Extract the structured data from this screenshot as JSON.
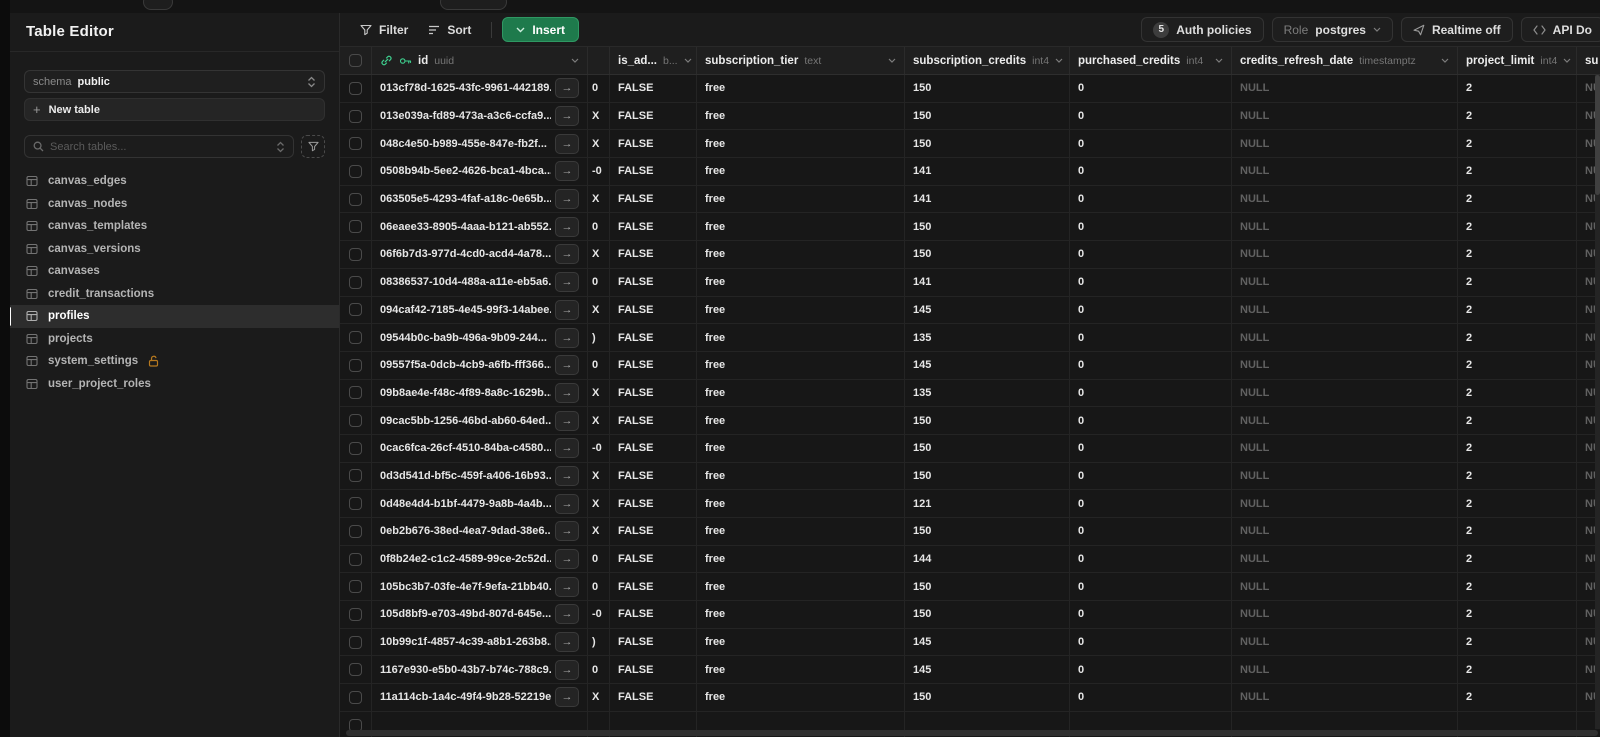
{
  "colors": {
    "accent_green": "#3ecf8e",
    "insert_button_bg": "#1e7a4c",
    "lock_amber": "#b7791f",
    "page_bg": "#171717",
    "sidebar_bg": "#1b1b1b",
    "header_bg": "#1f1f1f",
    "null_text": "#616161"
  },
  "sidebar": {
    "title": "Table Editor",
    "schema_label": "schema",
    "schema_value": "public",
    "new_table_label": "New table",
    "search_placeholder": "Search tables...",
    "tables": [
      {
        "name": "canvas_edges",
        "selected": false,
        "locked": false
      },
      {
        "name": "canvas_nodes",
        "selected": false,
        "locked": false
      },
      {
        "name": "canvas_templates",
        "selected": false,
        "locked": false
      },
      {
        "name": "canvas_versions",
        "selected": false,
        "locked": false
      },
      {
        "name": "canvases",
        "selected": false,
        "locked": false
      },
      {
        "name": "credit_transactions",
        "selected": false,
        "locked": false
      },
      {
        "name": "profiles",
        "selected": true,
        "locked": false
      },
      {
        "name": "projects",
        "selected": false,
        "locked": false
      },
      {
        "name": "system_settings",
        "selected": false,
        "locked": true
      },
      {
        "name": "user_project_roles",
        "selected": false,
        "locked": false
      }
    ]
  },
  "toolbar": {
    "filter_label": "Filter",
    "sort_label": "Sort",
    "insert_label": "Insert",
    "auth_policies_count": "5",
    "auth_policies_label": "Auth policies",
    "role_prefix": "Role",
    "role_value": "postgres",
    "realtime_label": "Realtime off",
    "api_docs_label": "API Do"
  },
  "grid": {
    "columns": [
      {
        "name": "id",
        "type": "uuid"
      },
      {
        "name": "",
        "type": ""
      },
      {
        "name": "is_ad...",
        "type": "b..."
      },
      {
        "name": "subscription_tier",
        "type": "text"
      },
      {
        "name": "subscription_credits",
        "type": "int4"
      },
      {
        "name": "purchased_credits",
        "type": "int4"
      },
      {
        "name": "credits_refresh_date",
        "type": "timestamptz"
      },
      {
        "name": "project_limit",
        "type": "int4"
      },
      {
        "name": "su",
        "type": ""
      }
    ],
    "rows": [
      {
        "id": "013cf78d-1625-43fc-9961-442189...",
        "fragment": "0",
        "is_admin": "FALSE",
        "tier": "free",
        "sub_credits": "150",
        "purchased": "0",
        "refresh": "NULL",
        "limit": "2",
        "su": "NULL"
      },
      {
        "id": "013e039a-fd89-473a-a3c6-ccfa9...",
        "fragment": "X",
        "is_admin": "FALSE",
        "tier": "free",
        "sub_credits": "150",
        "purchased": "0",
        "refresh": "NULL",
        "limit": "2",
        "su": "NULL"
      },
      {
        "id": "048c4e50-b989-455e-847e-fb2f...",
        "fragment": "X",
        "is_admin": "FALSE",
        "tier": "free",
        "sub_credits": "150",
        "purchased": "0",
        "refresh": "NULL",
        "limit": "2",
        "su": "NULL"
      },
      {
        "id": "0508b94b-5ee2-4626-bca1-4bca...",
        "fragment": "-0",
        "is_admin": "FALSE",
        "tier": "free",
        "sub_credits": "141",
        "purchased": "0",
        "refresh": "NULL",
        "limit": "2",
        "su": "NULL"
      },
      {
        "id": "063505e5-4293-4faf-a18c-0e65b...",
        "fragment": "X",
        "is_admin": "FALSE",
        "tier": "free",
        "sub_credits": "141",
        "purchased": "0",
        "refresh": "NULL",
        "limit": "2",
        "su": "NULL"
      },
      {
        "id": "06eaee33-8905-4aaa-b121-ab552...",
        "fragment": "0",
        "is_admin": "FALSE",
        "tier": "free",
        "sub_credits": "150",
        "purchased": "0",
        "refresh": "NULL",
        "limit": "2",
        "su": "NULL"
      },
      {
        "id": "06f6b7d3-977d-4cd0-acd4-4a78...",
        "fragment": "X",
        "is_admin": "FALSE",
        "tier": "free",
        "sub_credits": "150",
        "purchased": "0",
        "refresh": "NULL",
        "limit": "2",
        "su": "NULL"
      },
      {
        "id": "08386537-10d4-488a-a11e-eb5a6...",
        "fragment": "0",
        "is_admin": "FALSE",
        "tier": "free",
        "sub_credits": "141",
        "purchased": "0",
        "refresh": "NULL",
        "limit": "2",
        "su": "NULL"
      },
      {
        "id": "094caf42-7185-4e45-99f3-14abee...",
        "fragment": "X",
        "is_admin": "FALSE",
        "tier": "free",
        "sub_credits": "145",
        "purchased": "0",
        "refresh": "NULL",
        "limit": "2",
        "su": "NULL"
      },
      {
        "id": "09544b0c-ba9b-496a-9b09-244...",
        "fragment": ")",
        "is_admin": "FALSE",
        "tier": "free",
        "sub_credits": "135",
        "purchased": "0",
        "refresh": "NULL",
        "limit": "2",
        "su": "NULL"
      },
      {
        "id": "09557f5a-0dcb-4cb9-a6fb-fff366...",
        "fragment": "0",
        "is_admin": "FALSE",
        "tier": "free",
        "sub_credits": "145",
        "purchased": "0",
        "refresh": "NULL",
        "limit": "2",
        "su": "NULL"
      },
      {
        "id": "09b8ae4e-f48c-4f89-8a8c-1629b...",
        "fragment": "X",
        "is_admin": "FALSE",
        "tier": "free",
        "sub_credits": "135",
        "purchased": "0",
        "refresh": "NULL",
        "limit": "2",
        "su": "NULL"
      },
      {
        "id": "09cac5bb-1256-46bd-ab60-64ed...",
        "fragment": "X",
        "is_admin": "FALSE",
        "tier": "free",
        "sub_credits": "150",
        "purchased": "0",
        "refresh": "NULL",
        "limit": "2",
        "su": "NULL"
      },
      {
        "id": "0cac6fca-26cf-4510-84ba-c4580...",
        "fragment": "-0",
        "is_admin": "FALSE",
        "tier": "free",
        "sub_credits": "150",
        "purchased": "0",
        "refresh": "NULL",
        "limit": "2",
        "su": "NULL"
      },
      {
        "id": "0d3d541d-bf5c-459f-a406-16b93...",
        "fragment": "X",
        "is_admin": "FALSE",
        "tier": "free",
        "sub_credits": "150",
        "purchased": "0",
        "refresh": "NULL",
        "limit": "2",
        "su": "NULL"
      },
      {
        "id": "0d48e4d4-b1bf-4479-9a8b-4a4b...",
        "fragment": "X",
        "is_admin": "FALSE",
        "tier": "free",
        "sub_credits": "121",
        "purchased": "0",
        "refresh": "NULL",
        "limit": "2",
        "su": "NULL"
      },
      {
        "id": "0eb2b676-38ed-4ea7-9dad-38e6...",
        "fragment": "X",
        "is_admin": "FALSE",
        "tier": "free",
        "sub_credits": "150",
        "purchased": "0",
        "refresh": "NULL",
        "limit": "2",
        "su": "NULL"
      },
      {
        "id": "0f8b24e2-c1c2-4589-99ce-2c52d...",
        "fragment": "0",
        "is_admin": "FALSE",
        "tier": "free",
        "sub_credits": "144",
        "purchased": "0",
        "refresh": "NULL",
        "limit": "2",
        "su": "NULL"
      },
      {
        "id": "105bc3b7-03fe-4e7f-9efa-21bb40...",
        "fragment": "0",
        "is_admin": "FALSE",
        "tier": "free",
        "sub_credits": "150",
        "purchased": "0",
        "refresh": "NULL",
        "limit": "2",
        "su": "NULL"
      },
      {
        "id": "105d8bf9-e703-49bd-807d-645e...",
        "fragment": "-0",
        "is_admin": "FALSE",
        "tier": "free",
        "sub_credits": "150",
        "purchased": "0",
        "refresh": "NULL",
        "limit": "2",
        "su": "NULL"
      },
      {
        "id": "10b99c1f-4857-4c39-a8b1-263b8...",
        "fragment": ")",
        "is_admin": "FALSE",
        "tier": "free",
        "sub_credits": "145",
        "purchased": "0",
        "refresh": "NULL",
        "limit": "2",
        "su": "NULL"
      },
      {
        "id": "1167e930-e5b0-43b7-b74c-788c9...",
        "fragment": "0",
        "is_admin": "FALSE",
        "tier": "free",
        "sub_credits": "145",
        "purchased": "0",
        "refresh": "NULL",
        "limit": "2",
        "su": "NULL"
      },
      {
        "id": "11a114cb-1a4c-49f4-9b28-52219ec...",
        "fragment": "X",
        "is_admin": "FALSE",
        "tier": "free",
        "sub_credits": "150",
        "purchased": "0",
        "refresh": "NULL",
        "limit": "2",
        "su": "NULL"
      },
      {
        "id": "",
        "fragment": "",
        "is_admin": "",
        "tier": "",
        "sub_credits": "",
        "purchased": "",
        "refresh": "",
        "limit": "",
        "su": ""
      }
    ]
  }
}
